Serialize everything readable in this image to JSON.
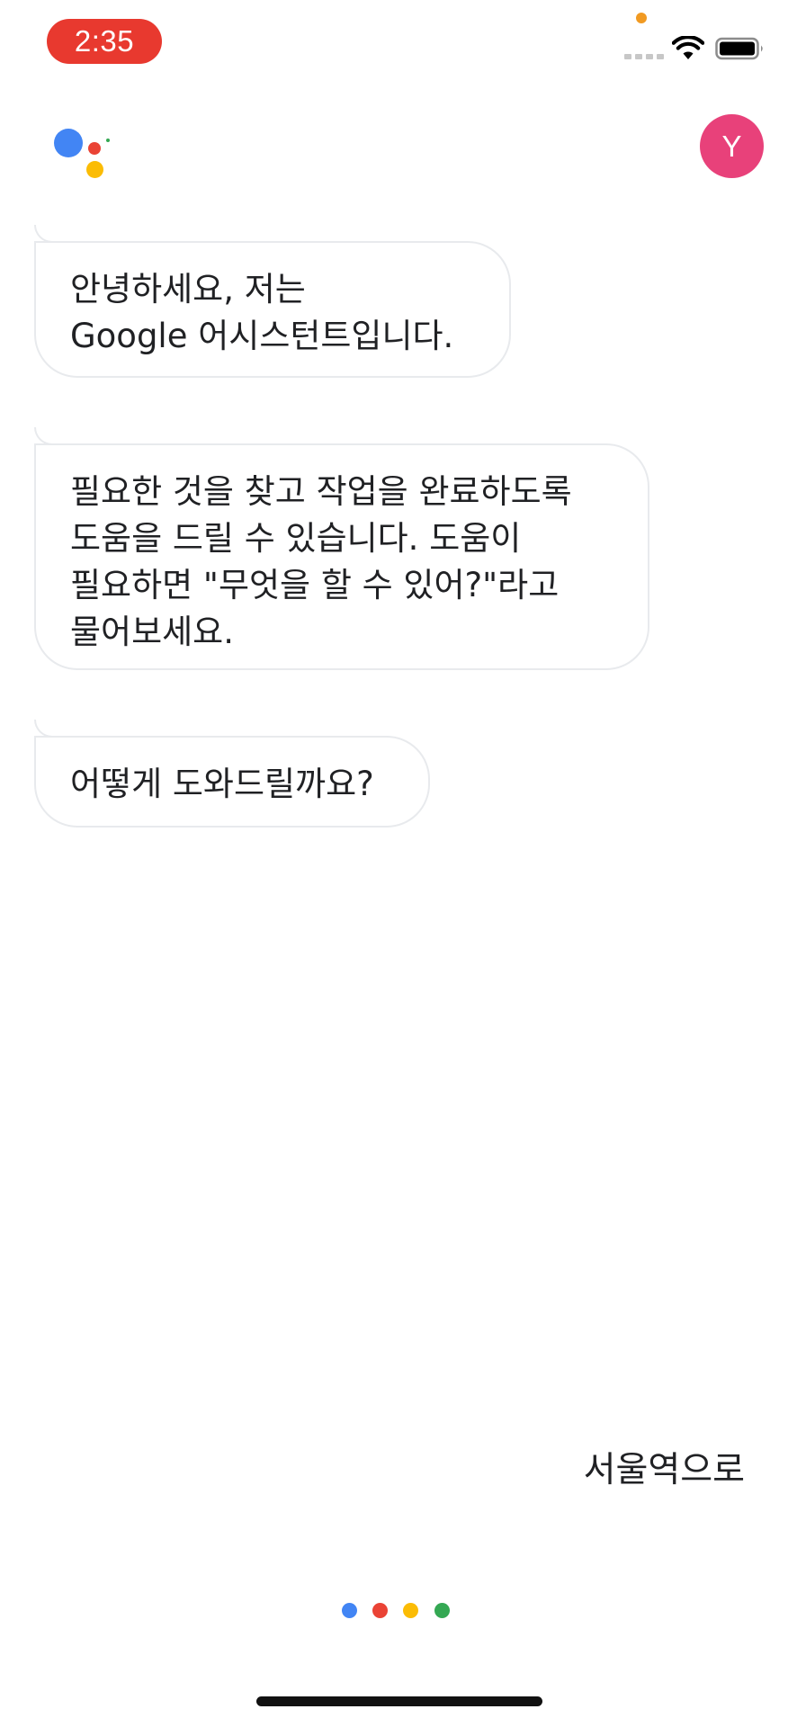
{
  "status_bar": {
    "time": "2:35",
    "time_pill_color": "#e8392f",
    "privacy_indicator_color": "#f19a22",
    "icons": [
      "cellular-signal-icon",
      "wifi-icon",
      "battery-icon"
    ]
  },
  "header": {
    "logo_icon": "google-assistant-logo-icon",
    "logo_colors": [
      "#4285f4",
      "#ea4335",
      "#fbbc05",
      "#34a853"
    ],
    "avatar_initial": "Y",
    "avatar_color": "#e8417a"
  },
  "messages": [
    {
      "sender": "assistant",
      "lines": [
        "안녕하세요, 저는",
        "Google 어시스턴트입니다."
      ]
    },
    {
      "sender": "assistant",
      "lines": [
        "필요한 것을 찾고 작업을 완료하도록",
        "도움을 드릴 수 있습니다. 도움이",
        "필요하면 \"무엇을 할 수 있어?\"라고",
        "물어보세요."
      ]
    },
    {
      "sender": "assistant",
      "lines": [
        "어떻게 도와드릴까요?"
      ]
    }
  ],
  "user_query": "서울역으로",
  "listening_indicator": {
    "icon": "listening-dots-icon",
    "colors": [
      "#4285f4",
      "#ea4335",
      "#fbbc05",
      "#34a853"
    ]
  }
}
